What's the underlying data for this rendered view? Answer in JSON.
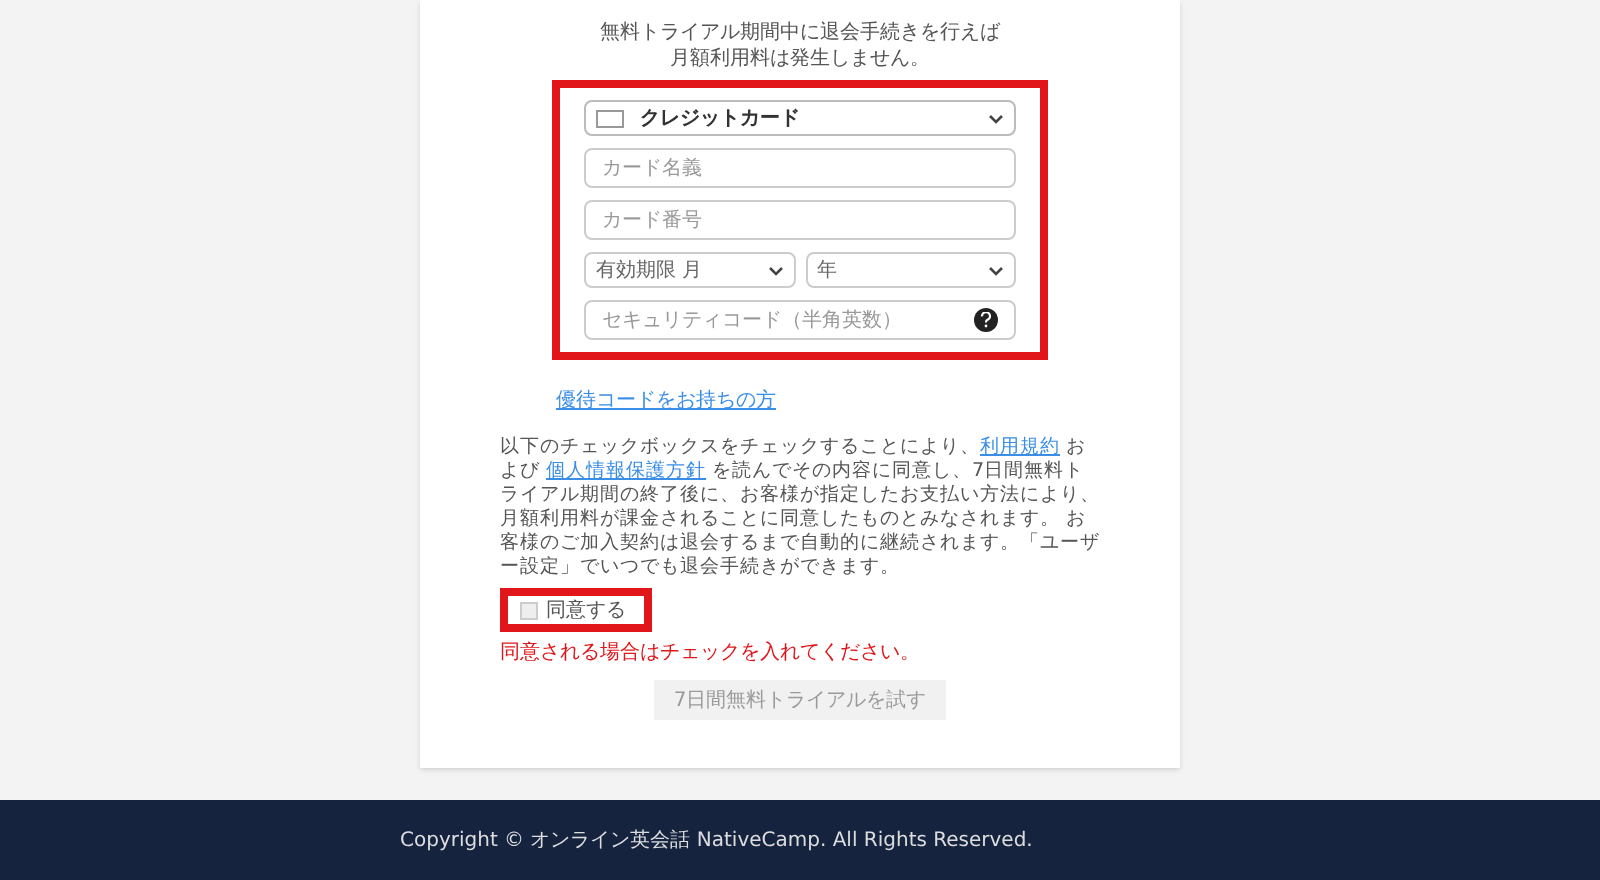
{
  "notice": [
    "無料トライアル期間中に退会手続きを行えば",
    "月額利用料は発生しません。"
  ],
  "payment_form": {
    "highlighted": true,
    "method": {
      "value": "クレジットカード"
    },
    "card_name": {
      "placeholder": "カード名義"
    },
    "card_number": {
      "placeholder": "カード番号"
    },
    "expiry_month": {
      "value": "有効期限 月"
    },
    "expiry_year": {
      "value": "年"
    },
    "security_code": {
      "placeholder": "セキュリティコード（半角英数）"
    }
  },
  "promo_link": "優待コードをお持ちの方",
  "terms": [
    {
      "kind": "text",
      "text": "以下のチェックボックスをチェックすることにより、"
    },
    {
      "kind": "link",
      "text": "利用規約"
    },
    {
      "kind": "text",
      "text": " および "
    },
    {
      "kind": "link",
      "text": "個人情報保護方針"
    },
    {
      "kind": "text",
      "text": " を読んでその内容に同意し、7日間無料トライアル期間の終了後に、お客様が指定したお支払い方法により、月額利用料が課金されることに同意したものとみなされます。 お客様のご加入契約は退会するまで自動的に継続されます。「ユーザー設定」でいつでも退会手続きができます。"
    }
  ],
  "agree": {
    "label": "同意する",
    "checked": false,
    "highlighted": true
  },
  "error": "同意される場合はチェックを入れてください。",
  "submit": {
    "label": "7日間無料トライアルを試す",
    "disabled": true
  },
  "footer": {
    "copyright": "Copyright © オンライン英会話 NativeCamp. All Rights Reserved."
  }
}
